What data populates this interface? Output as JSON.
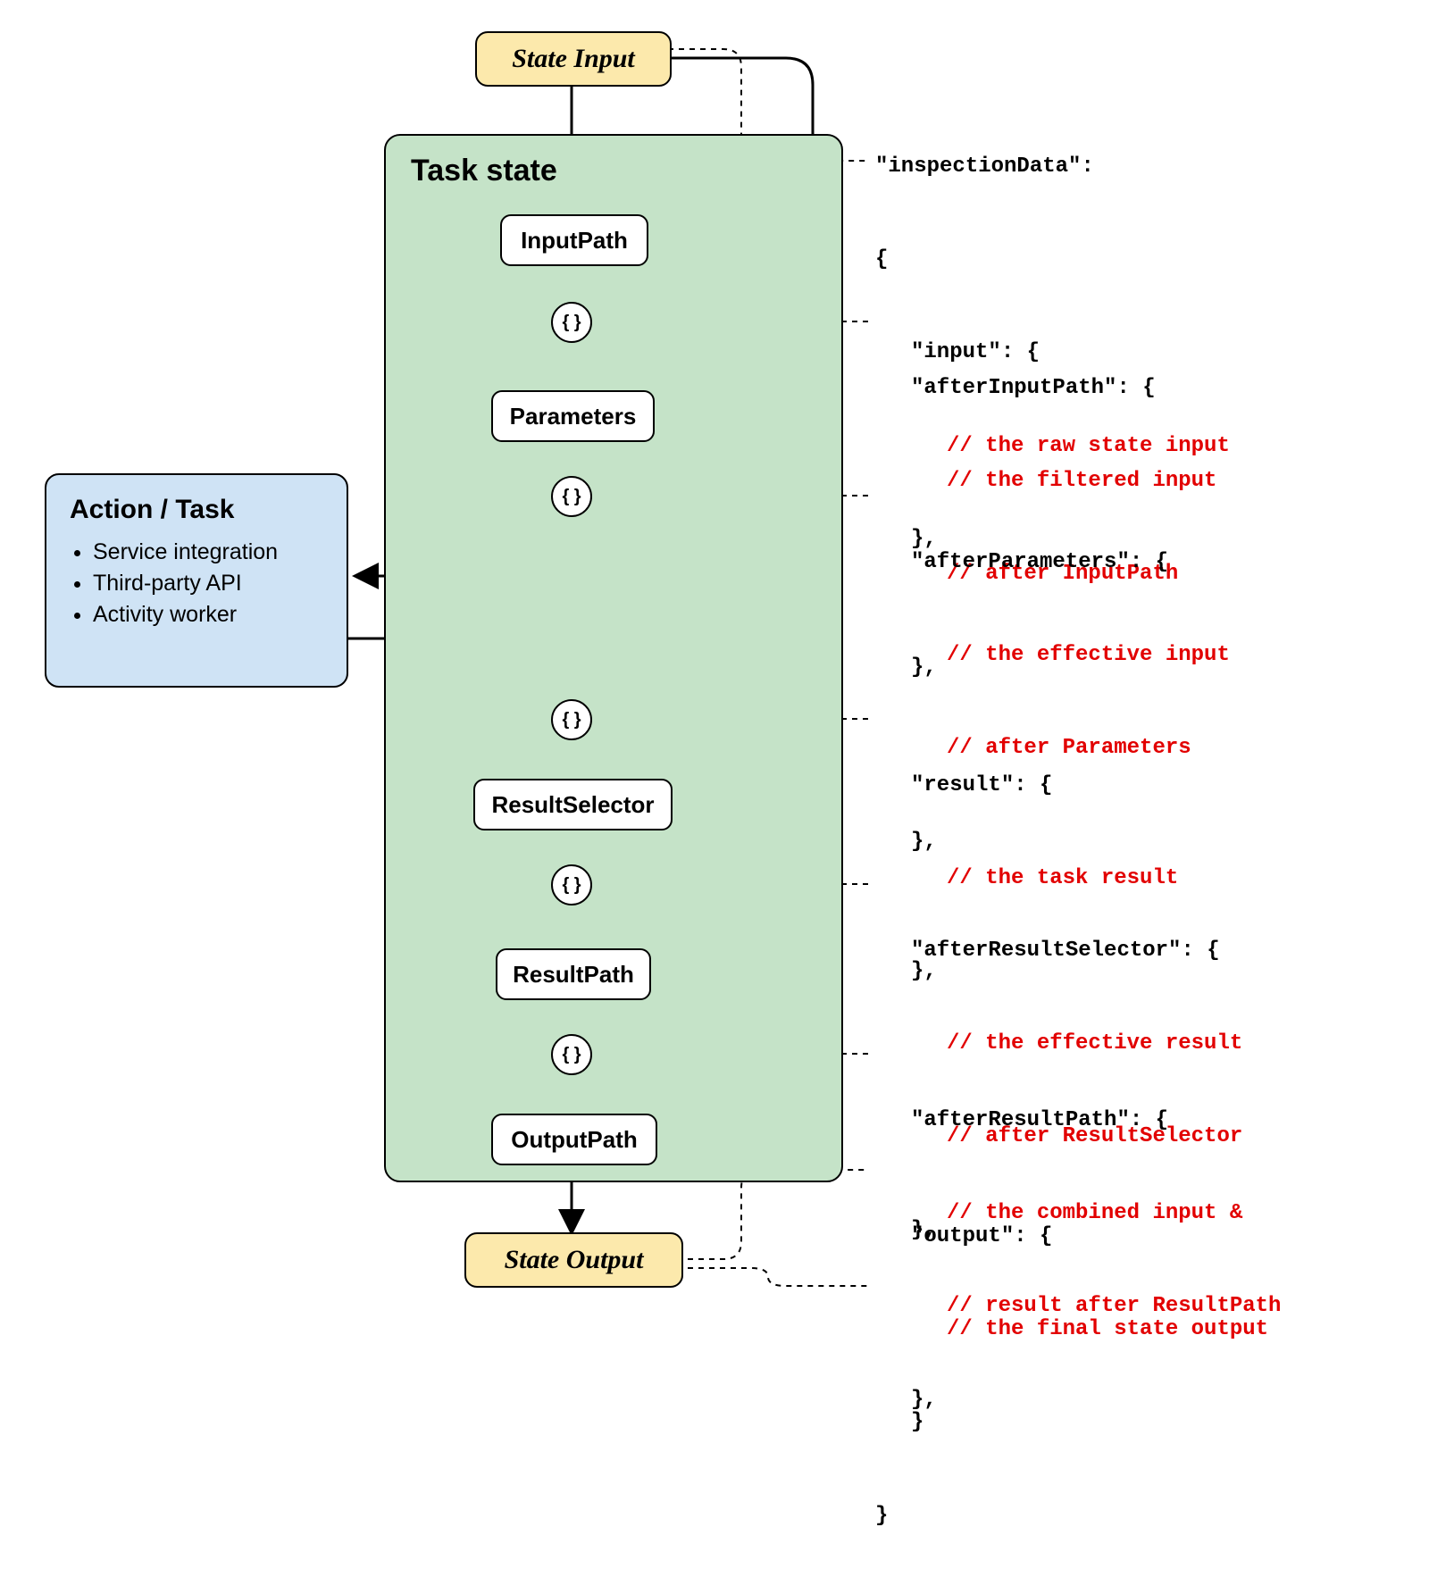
{
  "stateInput": "State Input",
  "stateOutput": "State Output",
  "taskStateTitle": "Task state",
  "steps": {
    "inputPath": "InputPath",
    "parameters": "Parameters",
    "resultSelector": "ResultSelector",
    "resultPath": "ResultPath",
    "outputPath": "OutputPath"
  },
  "braces": "{ }",
  "action": {
    "title": "Action / Task",
    "items": [
      "Service integration",
      "Third-party API",
      "Activity worker"
    ]
  },
  "code": {
    "header1": "\"inspectionData\":",
    "header2": "{",
    "input": {
      "key": "\"input\": {",
      "c1": "// the raw state input",
      "close": "},"
    },
    "afterInputPath": {
      "key": "\"afterInputPath\": {",
      "c1": "// the filtered input",
      "c2": "// after InputPath",
      "close": "},"
    },
    "afterParameters": {
      "key": "\"afterParameters\": {",
      "c1": "// the effective input",
      "c2": "// after Parameters",
      "close": "},"
    },
    "result": {
      "key": "\"result\": {",
      "c1": "// the task result",
      "close": "},"
    },
    "afterResultSelector": {
      "key": "\"afterResultSelector\": {",
      "c1": "// the effective result",
      "c2": "// after ResultSelector",
      "close": "},"
    },
    "afterResultPath": {
      "key": "\"afterResultPath\": {",
      "c1": "// the combined input &",
      "c2": "// result after ResultPath",
      "close": "},"
    },
    "output": {
      "key": "\"output\": {",
      "c1": "// the final state output",
      "close1": "}",
      "close2": "}"
    }
  }
}
